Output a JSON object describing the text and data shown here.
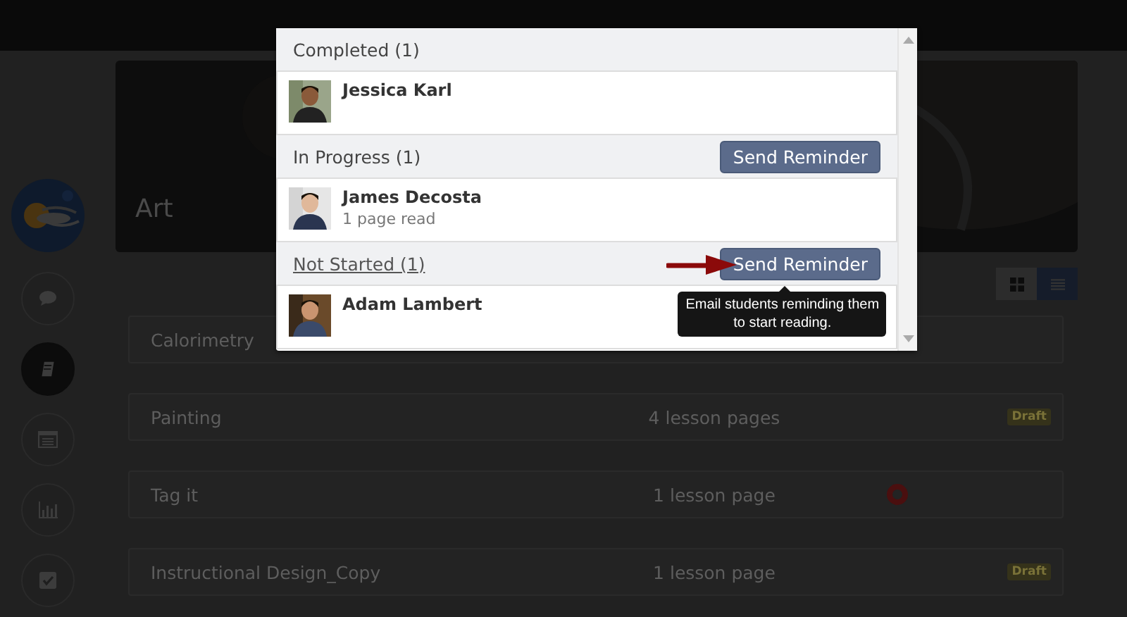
{
  "course": {
    "title": "Art"
  },
  "sidebar": [
    {
      "selected": false
    },
    {
      "selected": true
    },
    {
      "selected": false
    },
    {
      "selected": false
    },
    {
      "selected": false
    }
  ],
  "view_toggle": [
    {
      "selected": false
    },
    {
      "selected": true
    }
  ],
  "lessons": [
    {
      "title": "Calorimetry"
    },
    {
      "title": "Painting",
      "pages": "4 lesson pages",
      "badge": "Draft",
      "alert": false
    },
    {
      "title": "Tag it",
      "pages": "1 lesson page",
      "alert": true
    },
    {
      "title": "Instructional Design_Copy",
      "pages": "1 lesson page",
      "badge": "Draft",
      "alert": false
    }
  ],
  "modal": {
    "groups": [
      {
        "heading": "Completed (1)",
        "underlined": false,
        "students": [
          {
            "name": "Jessica Karl"
          }
        ]
      },
      {
        "heading": "In Progress (1)",
        "underlined": false,
        "button": "Send Reminder",
        "arrow": false,
        "students": [
          {
            "name": "James Decosta",
            "detail": "1 page read"
          }
        ]
      },
      {
        "heading": "Not Started (1)",
        "underlined": true,
        "button": "Send Reminder",
        "arrow": true,
        "tooltip": "Email students reminding them to start reading.",
        "students": [
          {
            "name": "Adam Lambert"
          }
        ]
      }
    ]
  }
}
